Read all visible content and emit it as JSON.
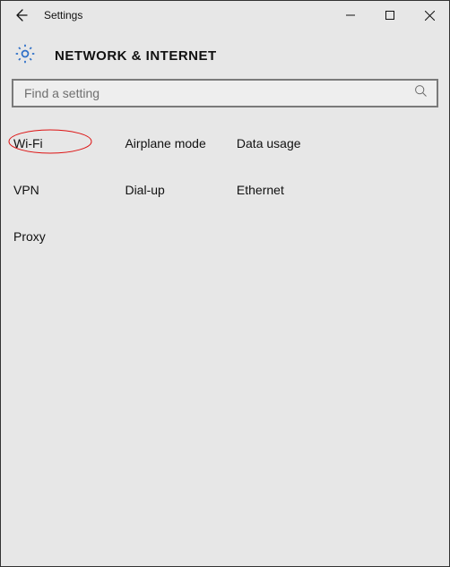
{
  "window": {
    "title": "Settings"
  },
  "header": {
    "title": "NETWORK & INTERNET"
  },
  "search": {
    "placeholder": "Find a setting",
    "value": ""
  },
  "nav": {
    "items": [
      {
        "label": "Wi-Fi",
        "highlighted": true
      },
      {
        "label": "Airplane mode"
      },
      {
        "label": "Data usage"
      },
      {
        "label": "VPN"
      },
      {
        "label": "Dial-up"
      },
      {
        "label": "Ethernet"
      },
      {
        "label": "Proxy"
      }
    ]
  }
}
